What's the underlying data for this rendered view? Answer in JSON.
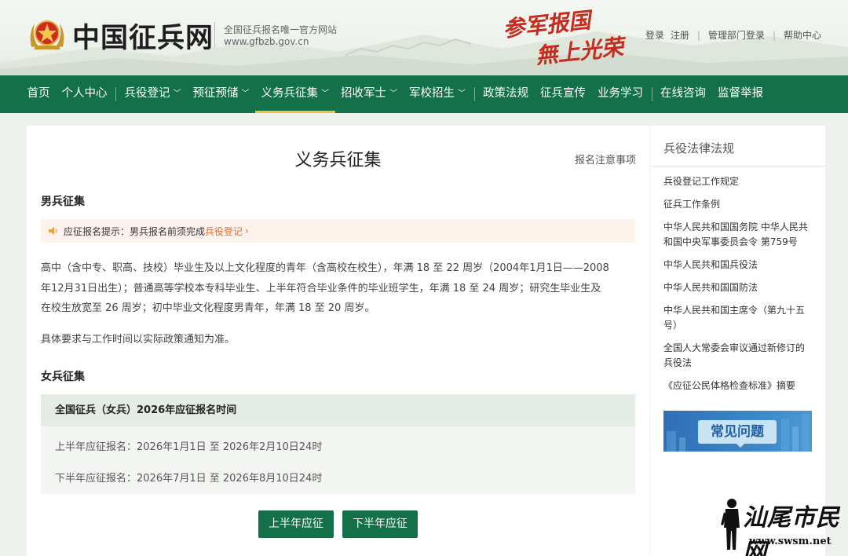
{
  "header": {
    "site_title": "中国征兵网",
    "site_sub1": "全国征兵报名唯一官方网站",
    "site_sub2": "www.gfbzb.gov.cn",
    "slogan_line1": "参军报国",
    "slogan_line2": "無上光荣",
    "links": [
      "登录",
      "注册",
      "管理部门登录",
      "帮助中心"
    ]
  },
  "nav": {
    "items": [
      {
        "label": "首页",
        "chev": ""
      },
      {
        "label": "个人中心",
        "chev": ""
      },
      {
        "label": "兵役登记",
        "chev": "﹀"
      },
      {
        "label": "预征预储",
        "chev": "﹀"
      },
      {
        "label": "义务兵征集",
        "chev": "﹀"
      },
      {
        "label": "招收军士",
        "chev": "﹀"
      },
      {
        "label": "军校招生",
        "chev": "﹀"
      },
      {
        "label": "政策法规",
        "chev": ""
      },
      {
        "label": "征兵宣传",
        "chev": ""
      },
      {
        "label": "业务学习",
        "chev": ""
      },
      {
        "label": "在线咨询",
        "chev": ""
      },
      {
        "label": "监督举报",
        "chev": ""
      }
    ],
    "active": "义务兵征集"
  },
  "main": {
    "title": "义务兵征集",
    "notice_link": "报名注意事项",
    "male_title": "男兵征集",
    "tip_prefix": "应征报名提示：男兵报名前须完成",
    "tip_link": "兵役登记",
    "tip_arrow": "›",
    "male_para_1": "高中（含中专、职高、技校）毕业生及以上文化程度的青年（含高校在校生），年满 18 至 22 周岁（2004年1月1日——2008",
    "male_para_2": "年12月31日出生）；普通高等学校本专科毕业生、上半年符合毕业条件的毕业班学生，年满 18 至 24 周岁；研究生毕业生及",
    "male_para_3": "在校生放宽至 26 周岁；初中毕业文化程度男青年，年满 18 至 20 周岁。",
    "male_note": "具体要求与工作时间以实际政策通知为准。",
    "female_title": "女兵征集",
    "female_box_title": "全国征兵（女兵）2026年应征报名时间",
    "female_first_half": "上半年应征报名：2026年1月1日 至 2026年2月10日24时",
    "female_second_half": "下半年应征报名：2026年7月1日 至 2026年8月10日24时",
    "btn_first": "上半年应征",
    "btn_second": "下半年应征"
  },
  "sidebar": {
    "title": "兵役法律法规",
    "items": [
      "兵役登记工作规定",
      "征兵工作条例",
      "中华人民共和国国务院 中华人民共和国中央军事委员会令 第759号",
      "中华人民共和国兵役法",
      "中华人民共和国国防法",
      "中华人民共和国主席令（第九十五号）",
      "全国人大常委会审议通过新修订的兵役法",
      "《应征公民体格检查标准》摘要"
    ],
    "faq_banner": "常见问题"
  },
  "watermark": {
    "text": "汕尾市民网",
    "url": "www.swsm.net"
  },
  "colors": {
    "nav_green": "#137048",
    "active_underline": "#f3c141",
    "slogan_red": "#c62c1d",
    "tip_link_orange": "#e0703a"
  }
}
